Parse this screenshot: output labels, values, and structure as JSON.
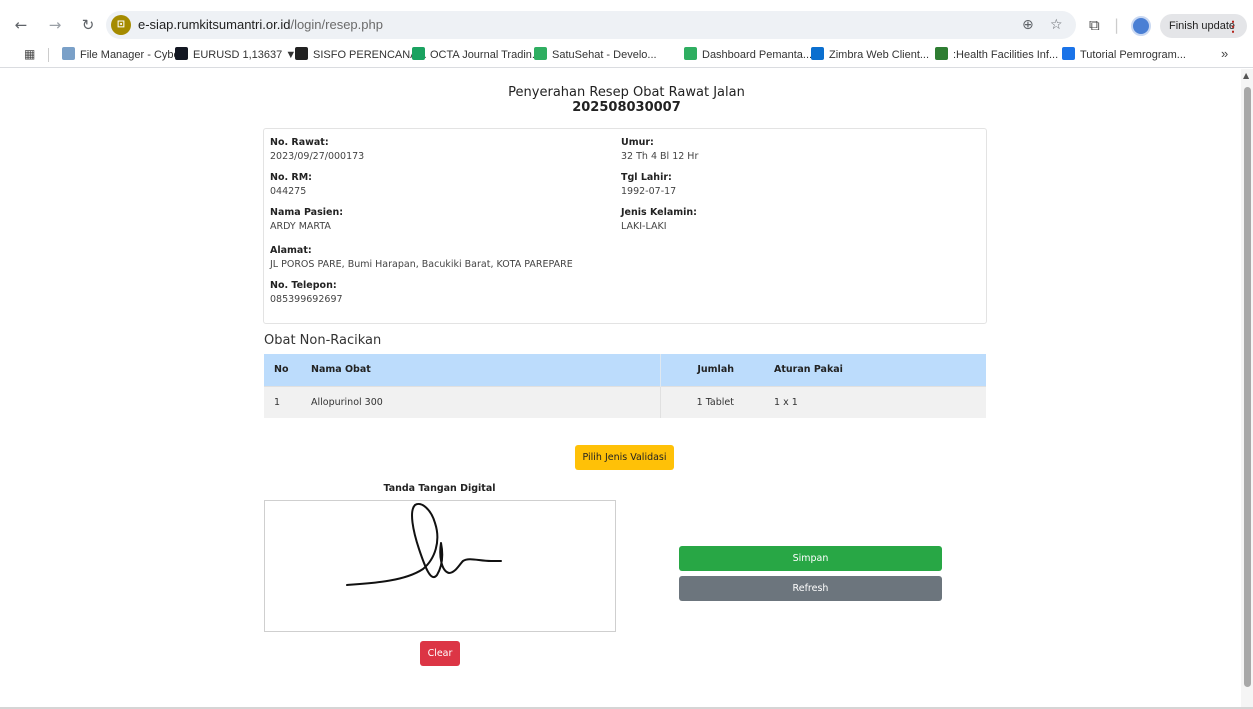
{
  "browser": {
    "url_host": "e-siap.rumkitsumantri.or.id",
    "url_path": "/login/resep.php",
    "finish_update_label": "Finish update",
    "bookmarks": [
      {
        "label": "File Manager - Cybe...",
        "icon": "diamond-icon",
        "color": "#7aa0c8"
      },
      {
        "label": "EURUSD 1,13637 ▼...",
        "icon": "tradingview-icon",
        "color": "#131722"
      },
      {
        "label": "SISFO PERENCANA...",
        "icon": "github-icon",
        "color": "#222222"
      },
      {
        "label": "OCTA Journal Tradin...",
        "icon": "plus-icon",
        "color": "#1aa260"
      },
      {
        "label": "SatuSehat - Develo...",
        "icon": "cross-icon",
        "color": "#2fae61"
      },
      {
        "label": "Dashboard Pemanta...",
        "icon": "cross-icon",
        "color": "#2fae61"
      },
      {
        "label": "Zimbra Web Client...",
        "icon": "zimbra-icon",
        "color": "#0b6fcf"
      },
      {
        "label": ":Health Facilities Inf...",
        "icon": "facility-icon",
        "color": "#2e7d32"
      },
      {
        "label": "Tutorial Pemrogram...",
        "icon": "circle-icon",
        "color": "#1a73e8"
      }
    ]
  },
  "page": {
    "title": "Penyerahan Resep Obat Rawat Jalan",
    "resep_no": "202508030007",
    "patient": {
      "no_rawat_label": "No. Rawat:",
      "no_rawat": "2023/09/27/000173",
      "no_rm_label": "No. RM:",
      "no_rm": "044275",
      "nama_label": "Nama Pasien:",
      "nama": "ARDY MARTA",
      "alamat_label": "Alamat:",
      "alamat": "JL POROS PARE, Bumi Harapan, Bacukiki Barat, KOTA PAREPARE",
      "telepon_label": "No. Telepon:",
      "telepon": "085399692697",
      "umur_label": "Umur:",
      "umur": "32 Th 4 Bl 12 Hr",
      "tgl_lahir_label": "Tgl Lahir:",
      "tgl_lahir": "1992-07-17",
      "jk_label": "Jenis Kelamin:",
      "jk": "LAKI-LAKI"
    },
    "section_title": "Obat Non-Racikan",
    "table": {
      "headers": [
        "No",
        "Nama Obat",
        "Jumlah",
        "Aturan Pakai"
      ],
      "rows": [
        {
          "no": "1",
          "nama": "Allopurinol 300",
          "jumlah": "1 Tablet",
          "aturan": "1 x 1"
        }
      ]
    },
    "validasi_button": "Pilih Jenis Validasi",
    "signature_label": "Tanda Tangan Digital",
    "clear_button": "Clear",
    "simpan_button": "Simpan",
    "refresh_button": "Refresh"
  }
}
